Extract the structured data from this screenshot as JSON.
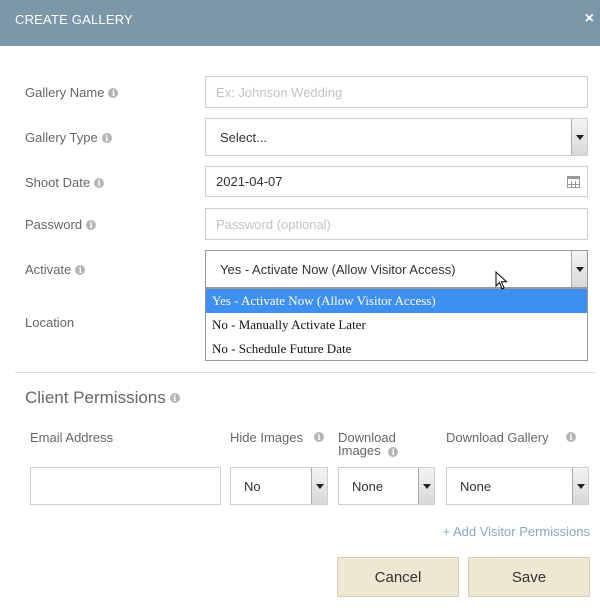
{
  "header": {
    "title": "CREATE GALLERY",
    "close_glyph": "×"
  },
  "form": {
    "gallery_name": {
      "label": "Gallery Name",
      "placeholder": "Ex: Johnson Wedding"
    },
    "gallery_type": {
      "label": "Gallery Type",
      "value": "Select..."
    },
    "shoot_date": {
      "label": "Shoot Date",
      "value": "2021-04-07"
    },
    "password": {
      "label": "Password",
      "placeholder": "Password (optional)"
    },
    "activate": {
      "label": "Activate",
      "value": "Yes - Activate Now (Allow Visitor Access)",
      "options": [
        "Yes - Activate Now (Allow Visitor Access)",
        "No - Manually Activate Later",
        "No - Schedule Future Date"
      ]
    },
    "location": {
      "label": "Location"
    }
  },
  "permissions": {
    "title": "Client Permissions",
    "columns": {
      "email": "Email Address",
      "hide_images": "Hide Images",
      "download_images_1": "Download",
      "download_images_2": "Images",
      "download_gallery": "Download Gallery"
    },
    "row": {
      "email": "",
      "hide_images": "No",
      "download_images": "None",
      "download_gallery": "None"
    },
    "add_link": "+ Add Visitor Permissions"
  },
  "actions": {
    "cancel": "Cancel",
    "save": "Save"
  },
  "colors": {
    "header": "#7c97a8",
    "selected_option": "#3d8ff0",
    "button": "#eee8d2",
    "link": "#8aa8c0"
  }
}
